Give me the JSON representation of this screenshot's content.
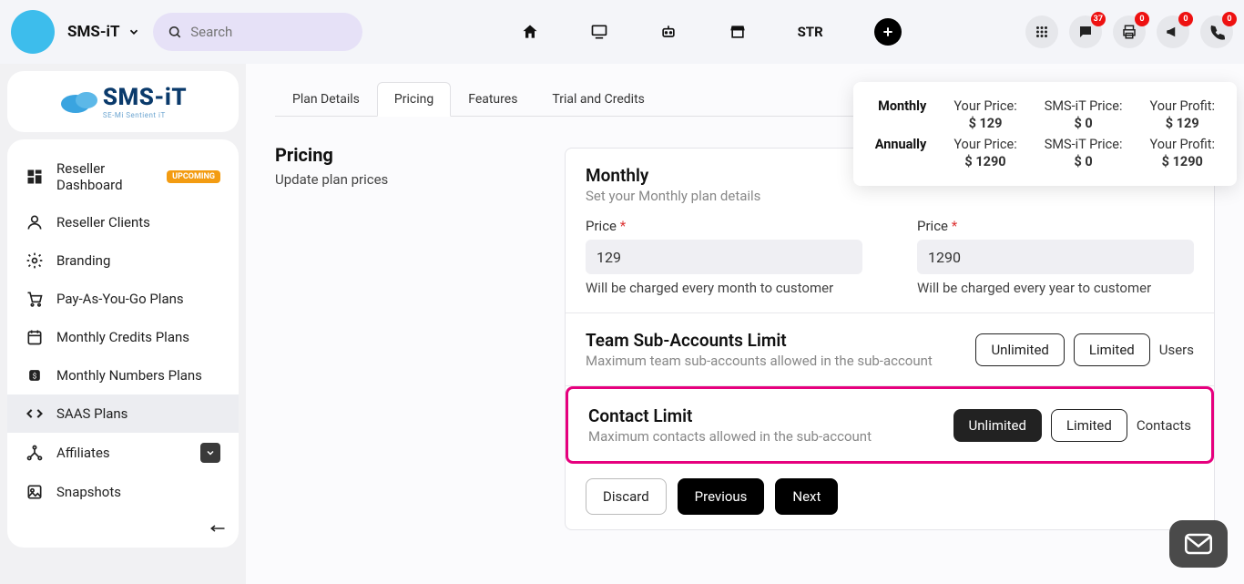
{
  "topbar": {
    "brand": "SMS-iT",
    "search_placeholder": "Search",
    "str_label": "STR",
    "badges": {
      "chat": "37",
      "print": "0",
      "announce": "0",
      "phone": "0"
    }
  },
  "sidebar": {
    "logo_title": "SMS-iT",
    "logo_sub": "SE-Mi Sentient iT",
    "items": [
      {
        "label": "Reseller Dashboard",
        "upcoming": "UPCOMING"
      },
      {
        "label": "Reseller Clients"
      },
      {
        "label": "Branding"
      },
      {
        "label": "Pay-As-You-Go Plans"
      },
      {
        "label": "Monthly Credits Plans"
      },
      {
        "label": "Monthly Numbers Plans"
      },
      {
        "label": "SAAS Plans"
      },
      {
        "label": "Affiliates"
      },
      {
        "label": "Snapshots"
      }
    ]
  },
  "tabs": {
    "plan_details": "Plan Details",
    "pricing": "Pricing",
    "features": "Features",
    "trial": "Trial and Credits"
  },
  "page": {
    "title": "Pricing",
    "subtitle": "Update plan prices"
  },
  "summary": {
    "monthly_label": "Monthly",
    "annually_label": "Annually",
    "your_price_label": "Your Price:",
    "smsit_price_label": "SMS-iT Price:",
    "your_profit_label": "Your Profit:",
    "monthly": {
      "your_price": "$ 129",
      "smsit_price": "$ 0",
      "profit": "$ 129"
    },
    "annually": {
      "your_price": "$ 1290",
      "smsit_price": "$ 0",
      "profit": "$ 1290"
    }
  },
  "monthly_section": {
    "title": "Monthly",
    "subtitle": "Set your Monthly plan details",
    "price_label": "Price",
    "monthly_value": "129",
    "annual_value": "1290",
    "monthly_note": "Will be charged every month to customer",
    "annual_note": "Will be charged every year to customer"
  },
  "team_section": {
    "title": "Team Sub-Accounts Limit",
    "subtitle": "Maximum team sub-accounts allowed in the sub-account",
    "unlimited": "Unlimited",
    "limited": "Limited",
    "suffix": "Users"
  },
  "contact_section": {
    "title": "Contact Limit",
    "subtitle": "Maximum contacts allowed in the sub-account",
    "unlimited": "Unlimited",
    "limited": "Limited",
    "suffix": "Contacts"
  },
  "actions": {
    "discard": "Discard",
    "previous": "Previous",
    "next": "Next"
  }
}
